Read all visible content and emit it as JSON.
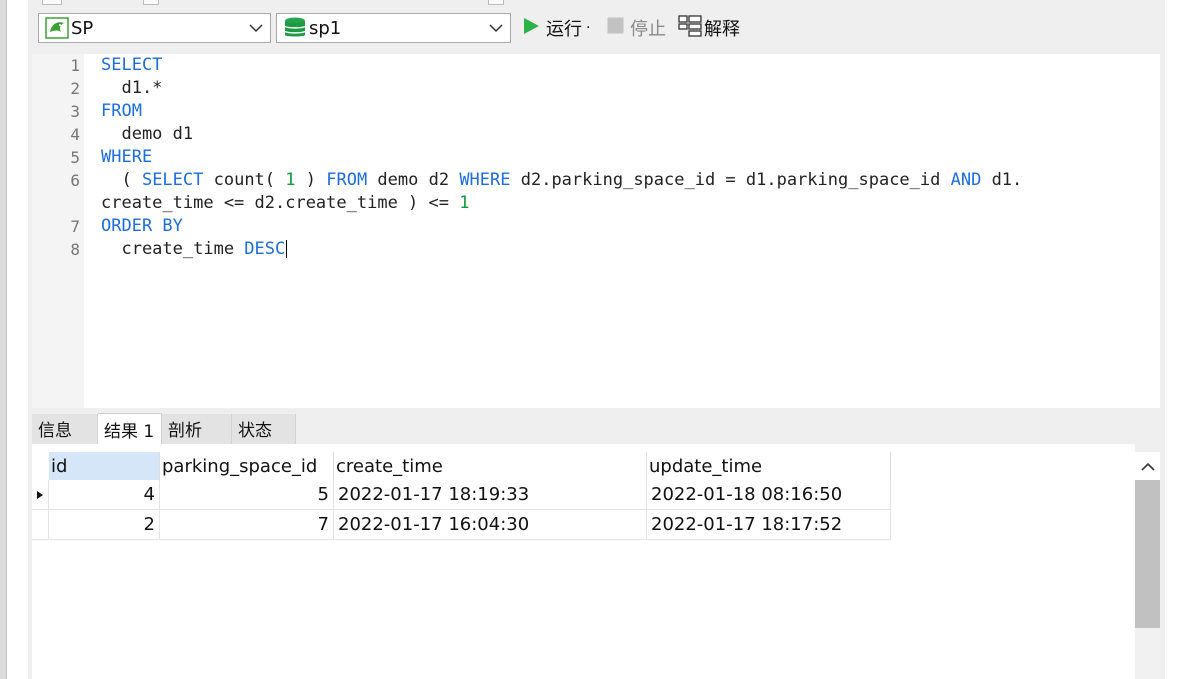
{
  "toolbar": {
    "connection_combo": {
      "value": "SP",
      "icon": "connection-icon"
    },
    "database_combo": {
      "value": "sp1",
      "icon": "database-icon"
    },
    "run_label": "运行",
    "run_dropdown": "·",
    "stop_label": "停止",
    "explain_label": "解释"
  },
  "editor": {
    "line_numbers": [
      "1",
      "2",
      "3",
      "4",
      "5",
      "6",
      "7",
      "8"
    ],
    "lines": [
      [
        {
          "t": "SELECT",
          "k": "kw"
        }
      ],
      [
        {
          "t": "  d1.*",
          "k": ""
        }
      ],
      [
        {
          "t": "FROM",
          "k": "kw"
        }
      ],
      [
        {
          "t": "  demo d1",
          "k": ""
        }
      ],
      [
        {
          "t": "WHERE",
          "k": "kw"
        }
      ],
      [
        {
          "t": "  ( ",
          "k": ""
        },
        {
          "t": "SELECT",
          "k": "kw"
        },
        {
          "t": " count( ",
          "k": ""
        },
        {
          "t": "1",
          "k": "num"
        },
        {
          "t": " ) ",
          "k": ""
        },
        {
          "t": "FROM",
          "k": "kw"
        },
        {
          "t": " demo d2 ",
          "k": ""
        },
        {
          "t": "WHERE",
          "k": "kw"
        },
        {
          "t": " d2.parking_space_id = d1.parking_space_id ",
          "k": ""
        },
        {
          "t": "AND",
          "k": "kw"
        },
        {
          "t": " d1.",
          "k": ""
        }
      ],
      [
        {
          "t": "create_time <= d2.create_time ) <= ",
          "k": ""
        },
        {
          "t": "1",
          "k": "num"
        }
      ],
      [
        {
          "t": "ORDER BY",
          "k": "kw"
        }
      ],
      [
        {
          "t": "  create_time ",
          "k": ""
        },
        {
          "t": "DESC",
          "k": "kw"
        }
      ]
    ]
  },
  "result_tabs": [
    {
      "label": "信息",
      "active": false
    },
    {
      "label": "结果 1",
      "active": true
    },
    {
      "label": "剖析",
      "active": false
    },
    {
      "label": "状态",
      "active": false
    }
  ],
  "grid": {
    "columns": [
      "id",
      "parking_space_id",
      "create_time",
      "update_time"
    ],
    "rows": [
      [
        "4",
        "5",
        "2022-01-17 18:19:33",
        "2022-01-18 08:16:50"
      ],
      [
        "2",
        "7",
        "2022-01-17 16:04:30",
        "2022-01-17 18:17:52"
      ]
    ]
  },
  "colors": {
    "keyword": "#1c6ee0",
    "number": "#0a9b3a",
    "run_green": "#2bb34a",
    "selected_header": "#d4e6f8"
  }
}
